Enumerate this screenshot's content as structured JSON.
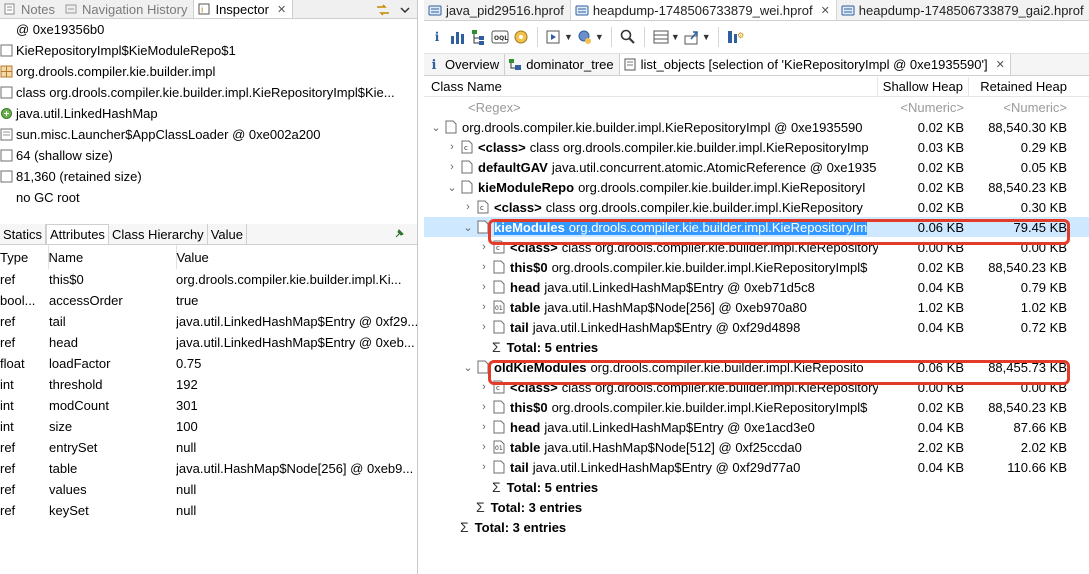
{
  "left_tabs": [
    {
      "label": "Notes",
      "active": false
    },
    {
      "label": "Navigation History",
      "active": false
    },
    {
      "label": "Inspector",
      "active": true
    }
  ],
  "inspector_info": [
    {
      "icon": "at-icon",
      "text": "@ 0xe19356b0"
    },
    {
      "icon": "class-icon",
      "text": "KieRepositoryImpl$KieModuleRepo$1"
    },
    {
      "icon": "package-icon",
      "text": "org.drools.compiler.kie.builder.impl"
    },
    {
      "icon": "class-icon",
      "text": "class org.drools.compiler.kie.builder.impl.KieRepositoryImpl$Kie..."
    },
    {
      "icon": "superclass-icon",
      "text": "java.util.LinkedHashMap"
    },
    {
      "icon": "classloader-icon",
      "text": "sun.misc.Launcher$AppClassLoader @ 0xe002a200"
    },
    {
      "icon": "size-icon",
      "text": "64 (shallow size)"
    },
    {
      "icon": "size-icon",
      "text": "81,360 (retained size)"
    },
    {
      "icon": "gc-icon",
      "text": "no GC root"
    }
  ],
  "attr_tabs": [
    {
      "label": "Statics",
      "active": false
    },
    {
      "label": "Attributes",
      "active": true
    },
    {
      "label": "Class Hierarchy",
      "active": false
    },
    {
      "label": "Value",
      "active": false
    }
  ],
  "attr_columns": {
    "type": "Type",
    "name": "Name",
    "value": "Value"
  },
  "attributes": [
    {
      "type": "ref",
      "name": "this$0",
      "value": "org.drools.compiler.kie.builder.impl.Ki..."
    },
    {
      "type": "bool...",
      "name": "accessOrder",
      "value": "true"
    },
    {
      "type": "ref",
      "name": "tail",
      "value": "java.util.LinkedHashMap$Entry @ 0xf29..."
    },
    {
      "type": "ref",
      "name": "head",
      "value": "java.util.LinkedHashMap$Entry @ 0xeb..."
    },
    {
      "type": "float",
      "name": "loadFactor",
      "value": "0.75"
    },
    {
      "type": "int",
      "name": "threshold",
      "value": "192"
    },
    {
      "type": "int",
      "name": "modCount",
      "value": "301"
    },
    {
      "type": "int",
      "name": "size",
      "value": "100"
    },
    {
      "type": "ref",
      "name": "entrySet",
      "value": "null"
    },
    {
      "type": "ref",
      "name": "table",
      "value": "java.util.HashMap$Node[256] @ 0xeb9..."
    },
    {
      "type": "ref",
      "name": "values",
      "value": "null"
    },
    {
      "type": "ref",
      "name": "keySet",
      "value": "null"
    }
  ],
  "file_tabs": [
    {
      "label": "java_pid29516.hprof",
      "active": false,
      "close": false
    },
    {
      "label": "heapdump-1748506733879_wei.hprof",
      "active": true,
      "close": true
    },
    {
      "label": "heapdump-1748506733879_gai2.hprof",
      "active": false,
      "close": false
    }
  ],
  "query_tabs": [
    {
      "label": "Overview",
      "icon": "info-icon",
      "active": false
    },
    {
      "label": "dominator_tree",
      "icon": "dominator-icon",
      "active": false
    },
    {
      "label": "list_objects  [selection of 'KieRepositoryImpl @ 0xe1935590']",
      "icon": "list-icon",
      "active": true,
      "close": true
    }
  ],
  "grid_header": {
    "name": "Class Name",
    "shallow": "Shallow Heap",
    "retained": "Retained Heap"
  },
  "grid_filter": {
    "name": "<Regex>",
    "shallow": "<Numeric>",
    "retained": "<Numeric>"
  },
  "rows": [
    {
      "indent": 0,
      "tw": "v",
      "icon": "obj",
      "bold": "",
      "rest": "org.drools.compiler.kie.builder.impl.KieRepositoryImpl @ 0xe1935590",
      "sh": "0.02 KB",
      "rh": "88,540.30 KB"
    },
    {
      "indent": 1,
      "tw": ">",
      "icon": "cls",
      "bold": "<class>",
      "rest": "class org.drools.compiler.kie.builder.impl.KieRepositoryImp",
      "sh": "0.03 KB",
      "rh": "0.29 KB"
    },
    {
      "indent": 1,
      "tw": ">",
      "icon": "obj",
      "bold": "defaultGAV",
      "rest": "java.util.concurrent.atomic.AtomicReference @ 0xe1935",
      "sh": "0.02 KB",
      "rh": "0.05 KB"
    },
    {
      "indent": 1,
      "tw": "v",
      "icon": "obj",
      "bold": "kieModuleRepo",
      "rest": "org.drools.compiler.kie.builder.impl.KieRepositoryI",
      "sh": "0.02 KB",
      "rh": "88,540.23 KB"
    },
    {
      "indent": 2,
      "tw": ">",
      "icon": "cls",
      "bold": "<class>",
      "rest": "class org.drools.compiler.kie.builder.impl.KieRepository",
      "sh": "0.02 KB",
      "rh": "0.30 KB"
    },
    {
      "indent": 2,
      "tw": "v",
      "icon": "obj",
      "bold": "kieModules",
      "rest": "org.drools.compiler.kie.builder.impl.KieRepositoryIm",
      "sh": "0.06 KB",
      "rh": "79.45 KB",
      "selected": true
    },
    {
      "indent": 3,
      "tw": ">",
      "icon": "cls",
      "bold": "<class>",
      "rest": "class org.drools.compiler.kie.builder.impl.KieRepository",
      "sh": "0.00 KB",
      "rh": "0.00 KB"
    },
    {
      "indent": 3,
      "tw": ">",
      "icon": "obj",
      "bold": "this$0",
      "rest": "org.drools.compiler.kie.builder.impl.KieRepositoryImpl$",
      "sh": "0.02 KB",
      "rh": "88,540.23 KB"
    },
    {
      "indent": 3,
      "tw": ">",
      "icon": "obj",
      "bold": "head",
      "rest": "java.util.LinkedHashMap$Entry @ 0xeb71d5c8",
      "sh": "0.04 KB",
      "rh": "0.79 KB"
    },
    {
      "indent": 3,
      "tw": ">",
      "icon": "arr",
      "bold": "table",
      "rest": "java.util.HashMap$Node[256] @ 0xeb970a80",
      "sh": "1.02 KB",
      "rh": "1.02 KB"
    },
    {
      "indent": 3,
      "tw": ">",
      "icon": "obj",
      "bold": "tail",
      "rest": "java.util.LinkedHashMap$Entry @ 0xf29d4898",
      "sh": "0.04 KB",
      "rh": "0.72 KB"
    },
    {
      "indent": 3,
      "tw": "",
      "icon": "sum",
      "bold": "",
      "rest": "Total: 5 entries",
      "sh": "",
      "rh": "",
      "total": true
    },
    {
      "indent": 2,
      "tw": "v",
      "icon": "obj",
      "bold": "oldKieModules",
      "rest": "org.drools.compiler.kie.builder.impl.KieReposito",
      "sh": "0.06 KB",
      "rh": "88,455.73 KB"
    },
    {
      "indent": 3,
      "tw": ">",
      "icon": "cls",
      "bold": "<class>",
      "rest": "class org.drools.compiler.kie.builder.impl.KieRepository",
      "sh": "0.00 KB",
      "rh": "0.00 KB"
    },
    {
      "indent": 3,
      "tw": ">",
      "icon": "obj",
      "bold": "this$0",
      "rest": "org.drools.compiler.kie.builder.impl.KieRepositoryImpl$",
      "sh": "0.02 KB",
      "rh": "88,540.23 KB"
    },
    {
      "indent": 3,
      "tw": ">",
      "icon": "obj",
      "bold": "head",
      "rest": "java.util.LinkedHashMap$Entry @ 0xe1acd3e0",
      "sh": "0.04 KB",
      "rh": "87.66 KB"
    },
    {
      "indent": 3,
      "tw": ">",
      "icon": "arr",
      "bold": "table",
      "rest": "java.util.HashMap$Node[512] @ 0xf25ccda0",
      "sh": "2.02 KB",
      "rh": "2.02 KB"
    },
    {
      "indent": 3,
      "tw": ">",
      "icon": "obj",
      "bold": "tail",
      "rest": "java.util.LinkedHashMap$Entry @ 0xf29d77a0",
      "sh": "0.04 KB",
      "rh": "110.66 KB"
    },
    {
      "indent": 3,
      "tw": "",
      "icon": "sum",
      "bold": "",
      "rest": "Total: 5 entries",
      "sh": "",
      "rh": "",
      "total": true
    },
    {
      "indent": 2,
      "tw": "",
      "icon": "sum",
      "bold": "",
      "rest": "Total: 3 entries",
      "sh": "",
      "rh": "",
      "total": true
    },
    {
      "indent": 1,
      "tw": "",
      "icon": "sum",
      "bold": "",
      "rest": "Total: 3 entries",
      "sh": "",
      "rh": "",
      "total": true
    }
  ],
  "colors": {
    "selection_row": "#cde8ff",
    "selection_text": "#3399ff",
    "annotation_box": "#e23b2a"
  }
}
